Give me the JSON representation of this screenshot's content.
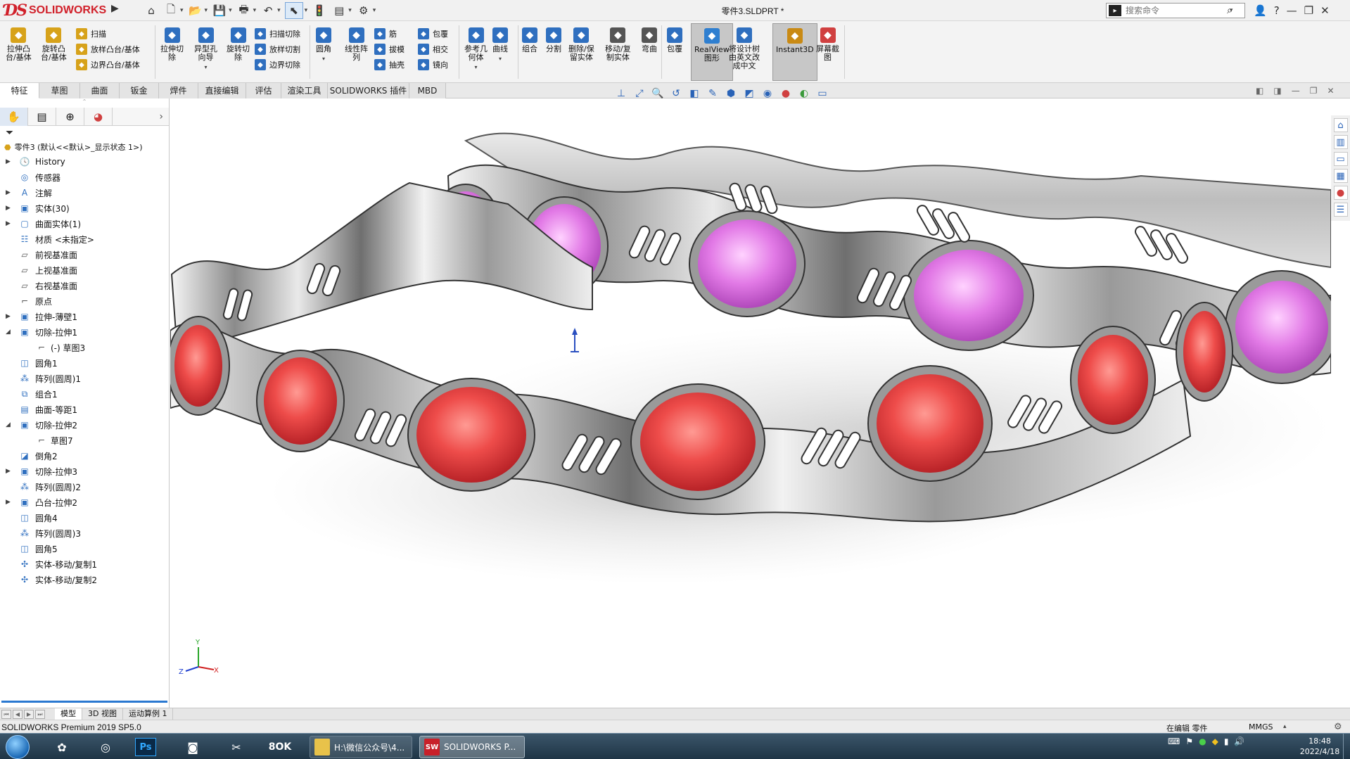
{
  "app": {
    "brand": "SOLIDWORKS",
    "doc_title": "零件3.SLDPRT *",
    "search_placeholder": "搜索命令"
  },
  "command_manager": {
    "big_buttons": [
      {
        "label": "拉伸凸\n台/基体",
        "icon": "extruded-boss-icon",
        "color": "#d7a21a"
      },
      {
        "label": "旋转凸\n台/基体",
        "icon": "revolved-boss-icon",
        "color": "#d7a21a"
      },
      {
        "label": "拉伸切\n除",
        "icon": "extruded-cut-icon",
        "color": "#2f6fbf"
      },
      {
        "label": "异型孔\n向导",
        "icon": "hole-wizard-icon",
        "color": "#2f6fbf"
      },
      {
        "label": "旋转切\n除",
        "icon": "revolved-cut-icon",
        "color": "#2f6fbf"
      },
      {
        "label": "圆角",
        "icon": "fillet-icon",
        "color": "#2f6fbf"
      },
      {
        "label": "线性阵\n列",
        "icon": "linear-pattern-icon",
        "color": "#2f6fbf"
      },
      {
        "label": "参考几\n何体",
        "icon": "reference-geometry-icon",
        "color": "#2f6fbf"
      },
      {
        "label": "曲线",
        "icon": "curves-icon",
        "color": "#2f6fbf"
      },
      {
        "label": "组合",
        "icon": "combine-icon",
        "color": "#2f6fbf"
      },
      {
        "label": "分割",
        "icon": "split-icon",
        "color": "#2f6fbf"
      },
      {
        "label": "删除/保\n留实体",
        "icon": "delete-body-icon",
        "color": "#2f6fbf"
      },
      {
        "label": "移动/复\n制实体",
        "icon": "move-copy-body-icon",
        "color": "#555555"
      },
      {
        "label": "弯曲",
        "icon": "flex-icon",
        "color": "#555555"
      },
      {
        "label": "包覆",
        "icon": "wrap-icon",
        "color": "#2f6fbf"
      },
      {
        "label": "RealView\n图形",
        "icon": "realview-icon",
        "color": "#2f7fd0"
      },
      {
        "label": "将设计树\n由英文改\n成中文",
        "icon": "design-tree-icon",
        "color": "#2f6fbf"
      },
      {
        "label": "Instant3D",
        "icon": "instant3d-icon",
        "color": "#c98a14"
      },
      {
        "label": "屏幕截\n图",
        "icon": "screenshot-icon",
        "color": "#d04040"
      }
    ],
    "small_buttons": [
      {
        "label": "扫描",
        "icon": "swept-boss-icon",
        "color": "#d7a21a"
      },
      {
        "label": "放样凸台/基体",
        "icon": "lofted-boss-icon",
        "color": "#d7a21a"
      },
      {
        "label": "边界凸台/基体",
        "icon": "boundary-boss-icon",
        "color": "#d7a21a"
      },
      {
        "label": "扫描切除",
        "icon": "swept-cut-icon",
        "color": "#2f6fbf"
      },
      {
        "label": "放样切割",
        "icon": "lofted-cut-icon",
        "color": "#2f6fbf"
      },
      {
        "label": "边界切除",
        "icon": "boundary-cut-icon",
        "color": "#2f6fbf"
      },
      {
        "label": "筋",
        "icon": "rib-icon",
        "color": "#2f6fbf"
      },
      {
        "label": "拔模",
        "icon": "draft-icon",
        "color": "#2f6fbf"
      },
      {
        "label": "抽壳",
        "icon": "shell-icon",
        "color": "#2f6fbf"
      },
      {
        "label": "包覆",
        "icon": "wrap-small-icon",
        "color": "#2f6fbf"
      },
      {
        "label": "相交",
        "icon": "intersect-icon",
        "color": "#2f6fbf"
      },
      {
        "label": "镜向",
        "icon": "mirror-icon",
        "color": "#2f6fbf"
      }
    ]
  },
  "tabs": [
    "特征",
    "草图",
    "曲面",
    "钣金",
    "焊件",
    "直接编辑",
    "评估",
    "渲染工具",
    "SOLIDWORKS 插件",
    "MBD"
  ],
  "active_tab": "特征",
  "feature_manager": {
    "root": "零件3 (默认<<默认>_显示状态 1>)",
    "tree": [
      {
        "label": "History",
        "icon": "history-icon",
        "exp": "▶"
      },
      {
        "label": "传感器",
        "icon": "sensor-icon",
        "exp": ""
      },
      {
        "label": "注解",
        "icon": "annotation-icon",
        "exp": "▶"
      },
      {
        "label": "实体(30)",
        "icon": "solid-bodies-icon",
        "exp": "▶"
      },
      {
        "label": "曲面实体(1)",
        "icon": "surface-bodies-icon",
        "exp": "▶"
      },
      {
        "label": "材质 <未指定>",
        "icon": "material-icon",
        "exp": ""
      },
      {
        "label": "前视基准面",
        "icon": "plane-icon",
        "exp": ""
      },
      {
        "label": "上视基准面",
        "icon": "plane-icon",
        "exp": ""
      },
      {
        "label": "右视基准面",
        "icon": "plane-icon",
        "exp": ""
      },
      {
        "label": "原点",
        "icon": "origin-icon",
        "exp": ""
      },
      {
        "label": "拉伸-薄壁1",
        "icon": "extrude-feature-icon",
        "exp": "▶"
      },
      {
        "label": "切除-拉伸1",
        "icon": "cut-feature-icon",
        "exp": "◢"
      },
      {
        "label": "(-) 草图3",
        "icon": "sketch-icon",
        "exp": "",
        "child": true
      },
      {
        "label": "圆角1",
        "icon": "fillet-feature-icon",
        "exp": ""
      },
      {
        "label": "阵列(圆周)1",
        "icon": "pattern-feature-icon",
        "exp": ""
      },
      {
        "label": "组合1",
        "icon": "combine-feature-icon",
        "exp": ""
      },
      {
        "label": "曲面-等距1",
        "icon": "offset-surface-icon",
        "exp": ""
      },
      {
        "label": "切除-拉伸2",
        "icon": "cut-feature-icon",
        "exp": "◢"
      },
      {
        "label": "草图7",
        "icon": "sketch-icon",
        "exp": "",
        "child": true
      },
      {
        "label": "倒角2",
        "icon": "chamfer-feature-icon",
        "exp": ""
      },
      {
        "label": "切除-拉伸3",
        "icon": "cut-feature-icon",
        "exp": "▶"
      },
      {
        "label": "阵列(圆周)2",
        "icon": "pattern-feature-icon",
        "exp": ""
      },
      {
        "label": "凸台-拉伸2",
        "icon": "extrude-feature-icon",
        "exp": "▶"
      },
      {
        "label": "圆角4",
        "icon": "fillet-feature-icon",
        "exp": ""
      },
      {
        "label": "阵列(圆周)3",
        "icon": "pattern-feature-icon",
        "exp": ""
      },
      {
        "label": "圆角5",
        "icon": "fillet-feature-icon",
        "exp": ""
      },
      {
        "label": "实体-移动/复制1",
        "icon": "move-body-feature-icon",
        "exp": ""
      },
      {
        "label": "实体-移动/复制2",
        "icon": "move-body-feature-icon",
        "exp": ""
      }
    ]
  },
  "bottom_tabs": [
    "模型",
    "3D 视图",
    "运动算例 1"
  ],
  "status": {
    "product": "SOLIDWORKS Premium 2019 SP5.0",
    "mode": "在编辑 零件",
    "units": "MMGS"
  },
  "taskbar": {
    "tasks": [
      {
        "label": "H:\\微信公众号\\4...",
        "icon": "folder-icon"
      },
      {
        "label": "SOLIDWORKS P...",
        "icon": "solidworks-icon"
      }
    ],
    "clock_time": "18:48",
    "clock_date": "2022/4/18"
  },
  "triad": {
    "x": "X",
    "y": "Y",
    "z": "Z"
  },
  "colors": {
    "accent": "#d1202a",
    "ring_front_gem": "#e23a3c",
    "ring_back_gem": "#e070e0",
    "metal": "#c9c9c9"
  }
}
